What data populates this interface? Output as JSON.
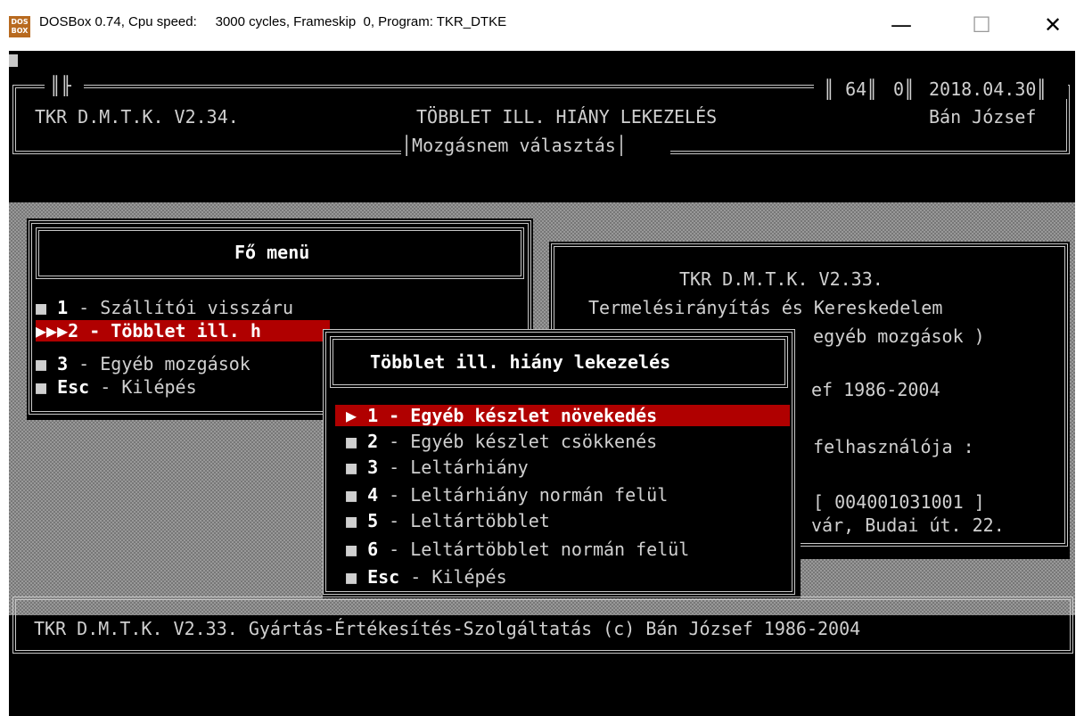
{
  "window": {
    "title": "DOSBox 0.74, Cpu speed:     3000 cycles, Frameskip  0, Program: TKR_DTKE",
    "icon_text": "DOS BOX",
    "minimize_glyph": "—",
    "maximize_glyph": "☐",
    "close_glyph": "✕"
  },
  "header": {
    "left": "TKR D.M.T.K. V2.34.",
    "center": "TÖBBLET ILL. HIÁNY LEKEZELÉS",
    "right": "Bán József",
    "counter1": "64",
    "counter2": "0",
    "date": "2018.04.30",
    "subtitle": "Mozgásnem választás"
  },
  "main_menu": {
    "title": "Fő menü",
    "items": [
      {
        "key": "1",
        "label": " - Szállítói visszáru",
        "bullet": "■"
      },
      {
        "key": "2",
        "label": " - Többlet ill. h",
        "bullet": "▶▶▶"
      },
      {
        "key": "3",
        "label": " - Egyéb mozgások",
        "bullet": "■"
      },
      {
        "key": "Esc",
        "label": " - Kilépés",
        "bullet": "■"
      }
    ]
  },
  "info_panel": {
    "lines": [
      "TKR D.M.T.K. V2.33.",
      "Termelésirányítás és Kereskedelem",
      " egyéb mozgások )",
      "ef 1986-2004",
      " felhasználója :",
      " [ 004001031001 ]",
      "vár, Budai út. 22."
    ]
  },
  "sub_menu": {
    "title": "Többlet ill. hiány lekezelés",
    "items": [
      {
        "key": "1",
        "label": " - Egyéb készlet növekedés",
        "bullet": "▶"
      },
      {
        "key": "2",
        "label": " - Egyéb készlet csökkenés",
        "bullet": "■"
      },
      {
        "key": "3",
        "label": " - Leltárhiány",
        "bullet": "■"
      },
      {
        "key": "4",
        "label": " - Leltárhiány normán felül",
        "bullet": "■"
      },
      {
        "key": "5",
        "label": " - Leltártöbblet",
        "bullet": "■"
      },
      {
        "key": "6",
        "label": " - Leltártöbblet normán felül",
        "bullet": "■"
      },
      {
        "key": "Esc",
        "label": " - Kilépés",
        "bullet": "■"
      }
    ]
  },
  "footer": {
    "text": "TKR D.M.T.K. V2.33. Gyártás-Értékesítés-Szolgáltatás (c) Bán József 1986-2004"
  }
}
